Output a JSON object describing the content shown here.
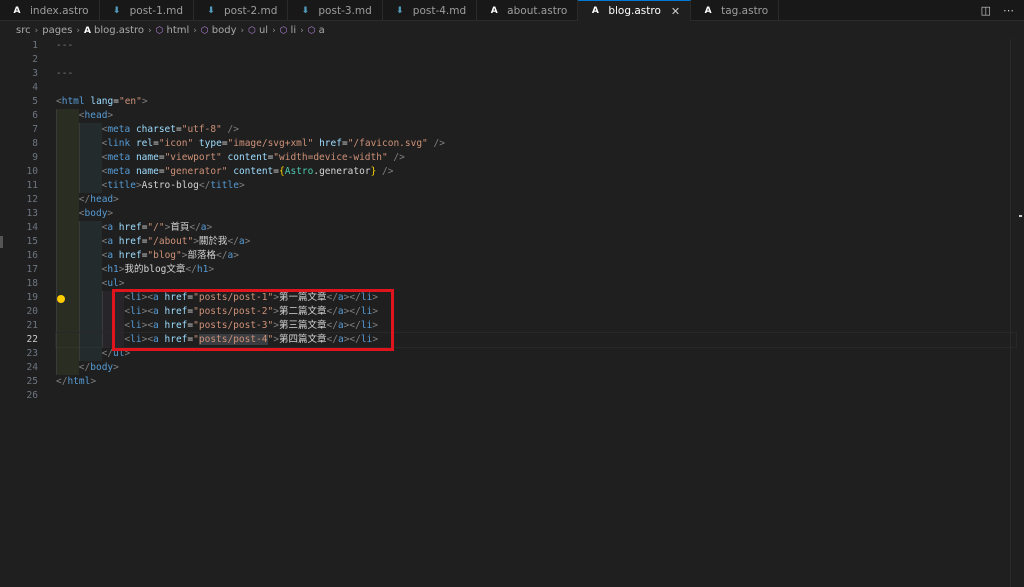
{
  "tabs": [
    {
      "label": "index.astro",
      "icon": "astro",
      "active": false
    },
    {
      "label": "post-1.md",
      "icon": "md",
      "active": false
    },
    {
      "label": "post-2.md",
      "icon": "md",
      "active": false
    },
    {
      "label": "post-3.md",
      "icon": "md",
      "active": false
    },
    {
      "label": "post-4.md",
      "icon": "md",
      "active": false
    },
    {
      "label": "about.astro",
      "icon": "astro",
      "active": false
    },
    {
      "label": "blog.astro",
      "icon": "astro",
      "active": true
    },
    {
      "label": "tag.astro",
      "icon": "astro",
      "active": false
    }
  ],
  "breadcrumb": [
    "src",
    "pages",
    "blog.astro",
    "html",
    "body",
    "ul",
    "li",
    "a"
  ],
  "current_line": 22,
  "code_lines": [
    "---",
    "",
    "---",
    "",
    "<html lang=\"en\">",
    "  <head>",
    "    <meta charset=\"utf-8\" />",
    "    <link rel=\"icon\" type=\"image/svg+xml\" href=\"/favicon.svg\" />",
    "    <meta name=\"viewport\" content=\"width=device-width\" />",
    "    <meta name=\"generator\" content={Astro.generator} />",
    "    <title>Astro-blog</title>",
    "  </head>",
    "  <body>",
    "    <a href=\"/\">首頁</a>",
    "    <a href=\"/about\">關於我</a>",
    "    <a href=\"blog\">部落格</a>",
    "    <h1>我的blog文章</h1>",
    "    <ul>",
    "      <li><a href=\"posts/post-1\">第一篇文章</a></li>",
    "      <li><a href=\"posts/post-2\">第二篇文章</a></li>",
    "      <li><a href=\"posts/post-3\">第三篇文章</a></li>",
    "      <li><a href=\"posts/post-4\">第四篇文章</a></li>",
    "    </ul>",
    "  </body>",
    "</html>",
    ""
  ],
  "selected_text": "posts/post-4",
  "colors": {
    "active_tab_border": "#0078d4",
    "highlight_box": "#e0141c",
    "lightbulb": "#ffcc00"
  }
}
